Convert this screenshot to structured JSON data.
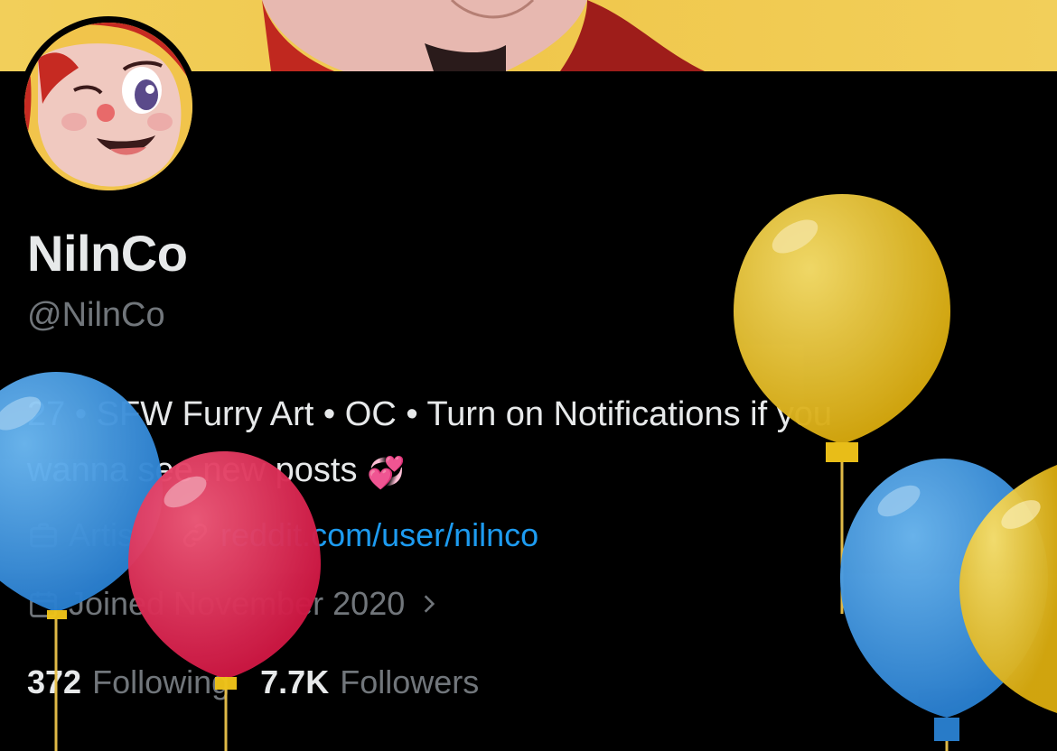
{
  "profile": {
    "display_name": "NilnCo",
    "handle": "@NilnCo",
    "bio_line1": "27 • SFW Furry Art • OC • Turn on Notifications if you",
    "bio_line2": "wanna see new posts",
    "bio_emoji": "💞",
    "profession": "Artist",
    "website": "reddit.com/user/nilnco",
    "joined": "Joined November 2020"
  },
  "stats": {
    "following_count": "372",
    "following_label": "Following",
    "followers_count": "7.7K",
    "followers_label": "Followers"
  },
  "icons": {
    "profession": "briefcase-icon",
    "website": "link-icon",
    "joined": "calendar-icon",
    "joined_expand": "chevron-right-icon"
  },
  "colors": {
    "background": "#000000",
    "accent": "#1d9bf0",
    "secondary_text": "#71767b",
    "balloon_yellow": "#f0c419",
    "balloon_blue": "#3d9be9",
    "balloon_red": "#e8264f"
  }
}
